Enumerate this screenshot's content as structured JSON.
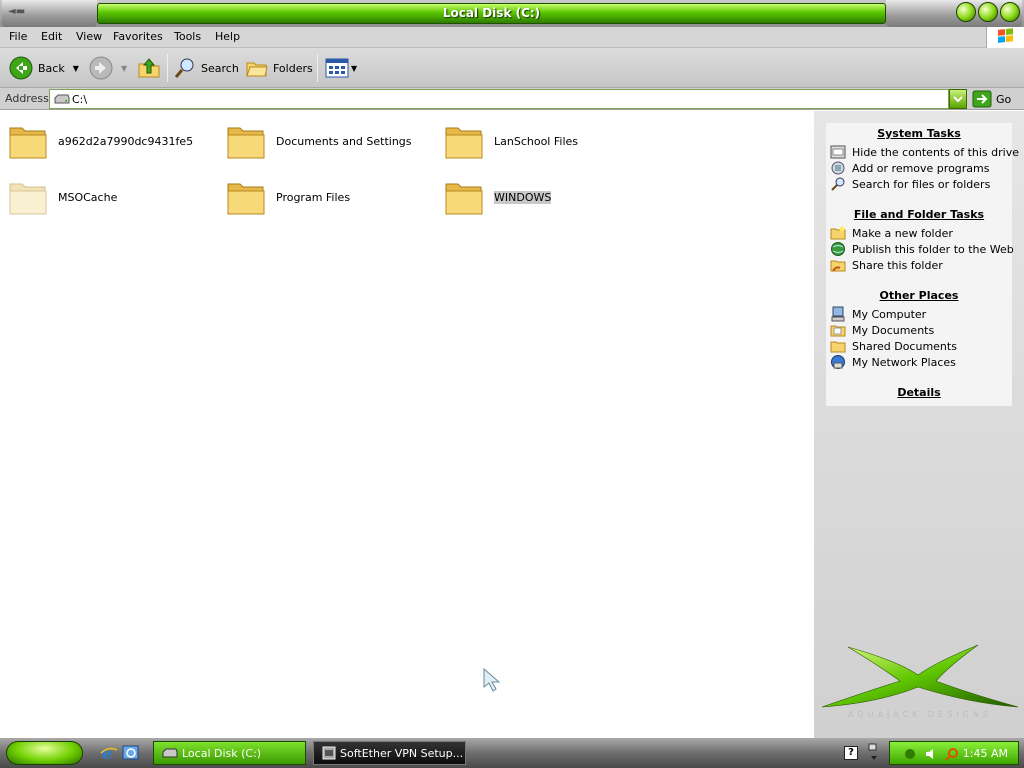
{
  "window": {
    "title": "Local Disk (C:)"
  },
  "menu": [
    "File",
    "Edit",
    "View",
    "Favorites",
    "Tools",
    "Help"
  ],
  "toolbar": {
    "back_label": "Back",
    "search_label": "Search",
    "folders_label": "Folders"
  },
  "address": {
    "label": "Address",
    "value": "C:\\",
    "go_label": "Go"
  },
  "folders": [
    {
      "name": "a962d2a7990dc9431fe5"
    },
    {
      "name": "Documents and Settings"
    },
    {
      "name": "LanSchool Files"
    },
    {
      "name": "MSOCache"
    },
    {
      "name": "Program Files"
    },
    {
      "name": "WINDOWS"
    }
  ],
  "taskpane": {
    "system_tasks": {
      "title": "System Tasks",
      "items": [
        "Hide the contents of this drive",
        "Add or remove programs",
        "Search for files or folders"
      ]
    },
    "file_folder_tasks": {
      "title": "File and Folder Tasks",
      "items": [
        "Make a new folder",
        "Publish this folder to the Web",
        "Share this folder"
      ]
    },
    "other_places": {
      "title": "Other Places",
      "items": [
        "My Computer",
        "My Documents",
        "Shared Documents",
        "My Network Places"
      ]
    },
    "details": {
      "title": "Details"
    },
    "branding": "AQUAJACK DESIGNS"
  },
  "taskbar": {
    "buttons": [
      "Local Disk (C:)",
      "SoftEther VPN Setup..."
    ],
    "clock": "1:45 AM"
  }
}
